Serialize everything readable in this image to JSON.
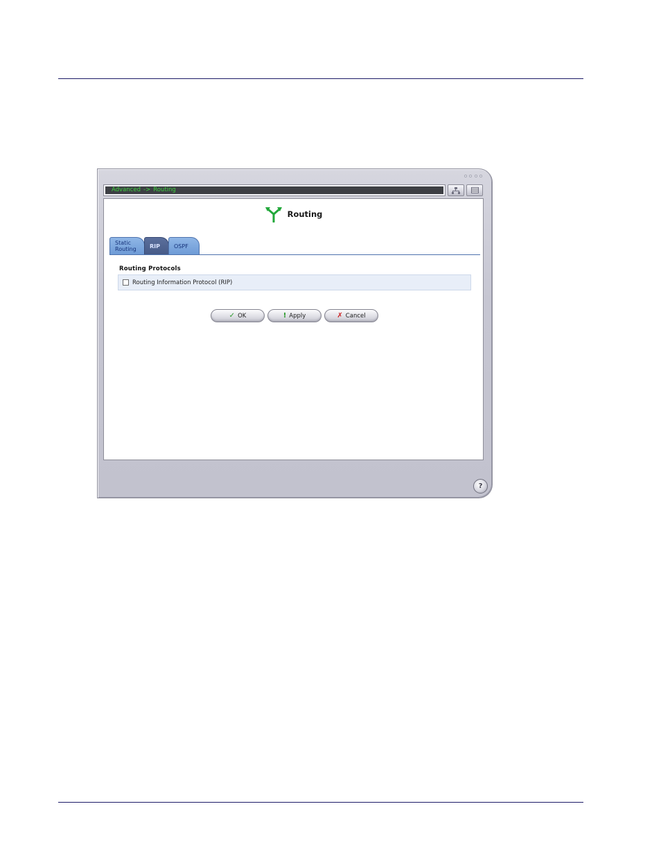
{
  "breadcrumb": {
    "parent": "Advanced",
    "separator": "->",
    "current": "Routing"
  },
  "page": {
    "title": "Routing"
  },
  "tabs": [
    {
      "label_line1": "Static",
      "label_line2": "Routing",
      "active": false
    },
    {
      "label": "RIP",
      "active": true
    },
    {
      "label": "OSPF",
      "active": false
    }
  ],
  "section": {
    "title": "Routing Protocols",
    "rip_checkbox_label": "Routing Information Protocol (RIP)",
    "rip_checked": false
  },
  "buttons": {
    "ok": "OK",
    "apply": "Apply",
    "cancel": "Cancel"
  },
  "icons": {
    "title": "routing-arrows-icon",
    "ok": "checkmark-icon",
    "apply": "exclamation-icon",
    "cancel": "x-icon",
    "help": "help-icon",
    "sitemap": "sitemap-icon",
    "menu": "menu-icon"
  },
  "glyphs": {
    "ok": "✓",
    "apply": "!",
    "cancel": "✗",
    "help": "?"
  },
  "colors": {
    "breadcrumb_text": "#3cd03c",
    "tab_active": "#475b88",
    "tab_inactive": "#7aa4dc",
    "title_icon": "#22a83a",
    "rule": "#1c1a66"
  }
}
